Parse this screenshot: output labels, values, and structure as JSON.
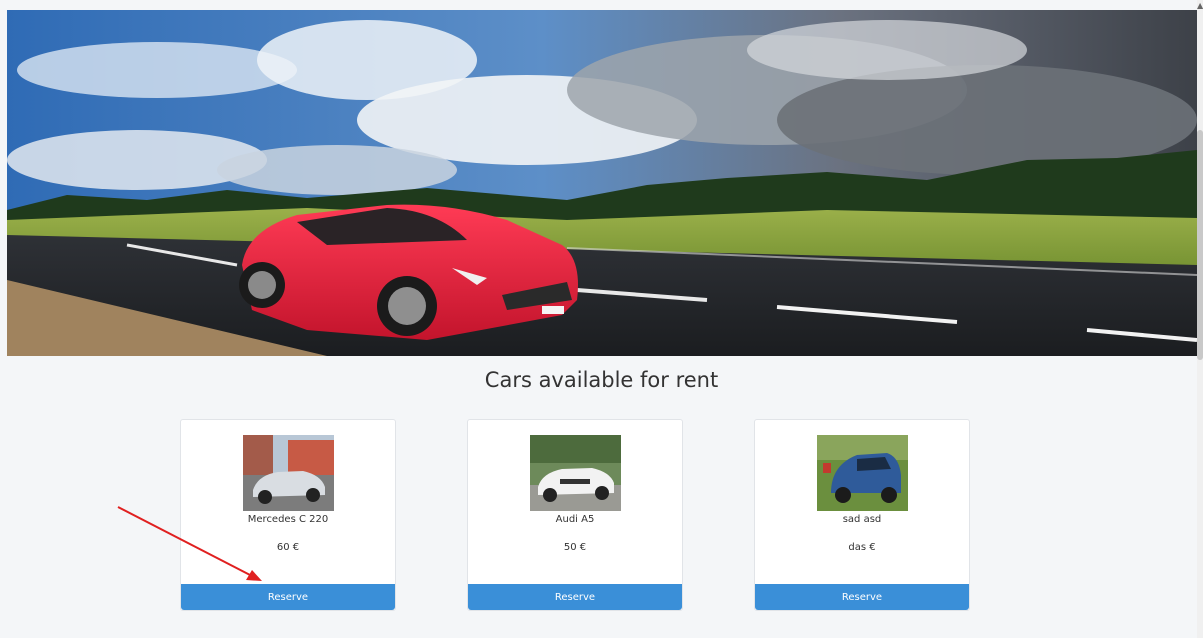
{
  "hero": {
    "image": "red-sports-car-on-mountain-road",
    "icon": "hero-image"
  },
  "section": {
    "title": "Cars available for rent"
  },
  "cars": [
    {
      "name": "Mercedes C 220",
      "price": "60 €",
      "reserve_label": "Reserve",
      "thumb": "silver-sedan"
    },
    {
      "name": "Audi A5",
      "price": "50 €",
      "reserve_label": "Reserve",
      "thumb": "white-convertible"
    },
    {
      "name": "sad asd",
      "price": "das €",
      "reserve_label": "Reserve",
      "thumb": "blue-suv"
    }
  ],
  "colors": {
    "accent": "#3a8fd8",
    "annotation": "#e02020",
    "background": "#f4f6f8"
  }
}
